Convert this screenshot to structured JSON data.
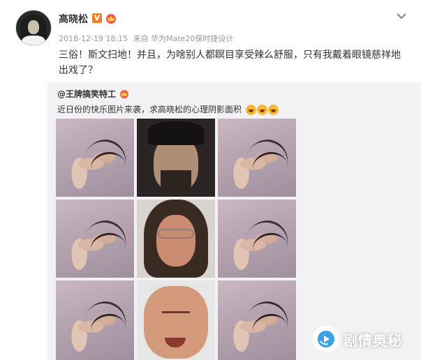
{
  "post": {
    "username": "高晓松",
    "verified_mark": "V",
    "timestamp": "2018-12-19 18:15",
    "source_prefix": "来自",
    "source_device": "华为Mate20保时捷设计",
    "content": "三俗！斯文扫地！并且，为啥别人都瞑目享受辣么舒服，只有我戴着眼镜慈祥地出戏了？"
  },
  "repost": {
    "username": "@王牌搞笑特工",
    "text": "近日份的快乐图片来袭，求高晓松的心理阴影面积",
    "emoji_count": 3,
    "images": [
      {
        "kind": "hands"
      },
      {
        "kind": "face-bearded"
      },
      {
        "kind": "hands"
      },
      {
        "kind": "hands"
      },
      {
        "kind": "face-glasses"
      },
      {
        "kind": "hands"
      },
      {
        "kind": "hands"
      },
      {
        "kind": "face-eyes-closed"
      },
      {
        "kind": "hands"
      }
    ]
  },
  "watermark": {
    "text": "剧情奥秘"
  },
  "colors": {
    "accent_orange": "#f27e22",
    "meta_gray": "#9a9a9a",
    "repost_bg": "#f2f2f5"
  }
}
